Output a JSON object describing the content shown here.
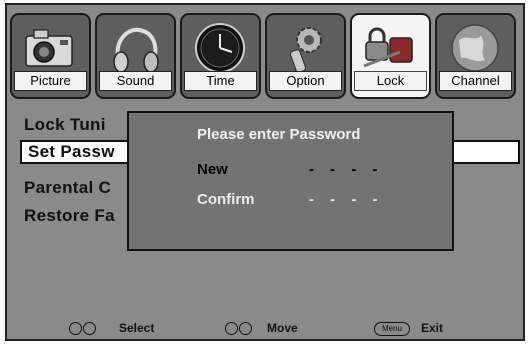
{
  "tabs": [
    {
      "label": "Picture",
      "icon": "camera-icon"
    },
    {
      "label": "Sound",
      "icon": "headphones-icon"
    },
    {
      "label": "Time",
      "icon": "clock-icon"
    },
    {
      "label": "Option",
      "icon": "gear-icon"
    },
    {
      "label": "Lock",
      "icon": "lock-key-icon",
      "active": true
    },
    {
      "label": "Channel",
      "icon": "globe-icon"
    }
  ],
  "menu": {
    "items": [
      "Lock Tuni",
      "Set Passw",
      "Parental C",
      "Restore Fa"
    ],
    "selected_index": 1
  },
  "dialog": {
    "title": "Please enter Password",
    "new_label": "New",
    "new_value": "- - - -",
    "confirm_label": "Confirm",
    "confirm_value": "- - - -"
  },
  "footer": {
    "select_label": "Select",
    "move_label": "Move",
    "menu_button": "Menu",
    "exit_label": "Exit"
  },
  "colors": {
    "background": "#8a8a8a",
    "active_tab": "#f4f4f4",
    "dialog_bg": "#737373",
    "highlight_text": "#000000"
  }
}
